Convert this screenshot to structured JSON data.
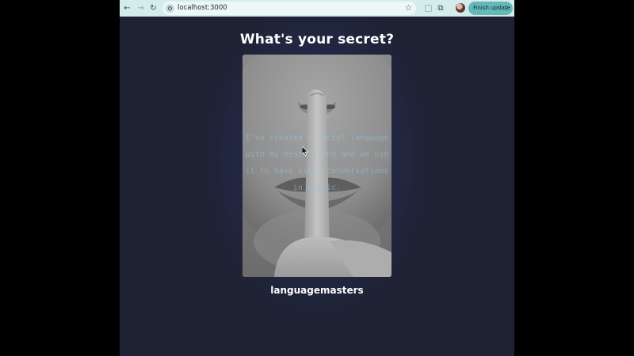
{
  "browser": {
    "url": "localhost:3000",
    "update_button_label": "Finish update",
    "nav_back_icon": "arrow-left",
    "nav_forward_icon": "arrow-right",
    "reload_icon": "reload",
    "bookmark_icon": "star-outline",
    "extensions_icon": "puzzle"
  },
  "page": {
    "title": "What's your secret?",
    "secret": {
      "text": "I've created a secret language with my best friend and we use it to have silly conversations in public.",
      "image": "hush-finger-on-lips-photo"
    },
    "username": "languagemasters"
  },
  "colors": {
    "page_background": "#1f2233",
    "glow": "#2a3465",
    "toolbar": "#d4ecec",
    "update_button": "#64b8b8",
    "title_text": "#ffffff",
    "secret_text": "#96c4e1"
  }
}
